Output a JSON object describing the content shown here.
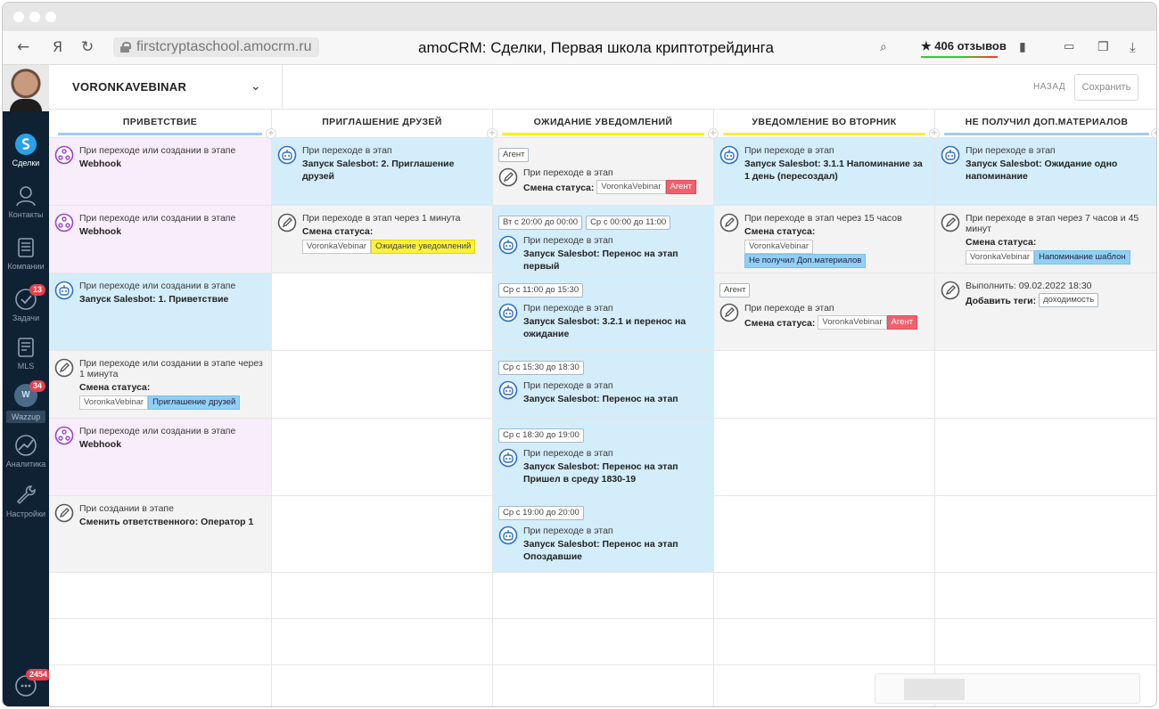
{
  "browser": {
    "url": "firstcryptaschool.amocrm.ru",
    "page_title": "amoCRM: Сделки, Первая школа криптотрейдинга",
    "reviews": "★ 406 отзывов"
  },
  "sidebar": {
    "items": [
      {
        "label": "Сделки"
      },
      {
        "label": "Контакты"
      },
      {
        "label": "Компании"
      },
      {
        "label": "Задачи",
        "badge": "13"
      },
      {
        "label": "MLS"
      },
      {
        "label": "Wazzup",
        "badge": "34",
        "avatar_text": "W"
      },
      {
        "label": "Аналитика"
      },
      {
        "label": "Настройки"
      }
    ],
    "chat_badge": "2454"
  },
  "header": {
    "pipeline": "VORONKAVEBINAR",
    "back": "НАЗАД",
    "save": "Сохранить"
  },
  "columns": [
    {
      "title": "ПРИВЕТСТВИЕ",
      "color": "#99ccfd"
    },
    {
      "title": "ПРИГЛАШЕНИЕ ДРУЗЕЙ",
      "color": "#ffffff"
    },
    {
      "title": "ОЖИДАНИЕ УВЕДОМЛЕНИЙ",
      "color": "#fff000"
    },
    {
      "title": "УВЕДОМЛЕНИЕ ВО ВТОРНИК",
      "color": "#ffeb3b"
    },
    {
      "title": "НЕ ПОЛУЧИЛ ДОП.МАТЕРИАЛОВ",
      "color": "#99ccfd"
    }
  ],
  "cells": {
    "c0r0": {
      "small": "При переходе или создании в этапе",
      "bold": "Webhook"
    },
    "c0r1": {
      "small": "При переходе или создании в этапе",
      "bold": "Webhook"
    },
    "c0r2": {
      "small": "При переходе или создании в этапе",
      "bold": "Запуск Salesbot: 1. Приветствие"
    },
    "c0r3": {
      "small": "При переходе или создании в этапе через 1 минута",
      "bold": "Смена статуса:",
      "chip1": "VoronkaVebinar",
      "chip2": "Приглашение друзей"
    },
    "c0r4": {
      "small": "При переходе или создании в этапе",
      "bold": "Webhook"
    },
    "c0r5": {
      "small": "При создании в этапе",
      "bold": "Сменить ответственного: Оператор 1"
    },
    "c1r0": {
      "small": "При переходе в этап",
      "bold": "Запуск Salesbot: 2. Приглашение друзей"
    },
    "c1r1": {
      "small": "При переходе в этап через 1 минута",
      "bold": "Смена статуса:",
      "chip1": "VoronkaVebinar",
      "chip2": "Ожидание уведомлений"
    },
    "c2r0": {
      "tag": "Агент",
      "small": "При переходе в этап",
      "bold": "Смена статуса:",
      "chip1": "VoronkaVebinar",
      "chip2": "Агент"
    },
    "c2r1": {
      "tag": "Вт с 20:00 до 00:00",
      "tag2": "Ср с 00:00 до 11:00",
      "small": "При переходе в этап",
      "bold": "Запуск Salesbot: Перенос на этап первый"
    },
    "c2r2": {
      "tag": "Ср с 11:00 до 15:30",
      "small": "При переходе в этап",
      "bold": "Запуск Salesbot: 3.2.1 и перенос на ожидание"
    },
    "c2r3": {
      "tag": "Ср с 15:30 до 18:30",
      "small": "При переходе в этап",
      "bold": "Запуск Salesbot: Перенос на этап"
    },
    "c2r4": {
      "tag": "Ср с 18:30 до 19:00",
      "small": "При переходе в этап",
      "bold": "Запуск Salesbot: Перенос на этап Пришел в среду 1830-19"
    },
    "c2r5": {
      "tag": "Ср с 19:00 до 20:00",
      "small": "При переходе в этап",
      "bold": "Запуск Salesbot: Перенос на этап Опоздавшие"
    },
    "c3r0": {
      "small": "При переходе в этап",
      "bold": "Запуск Salesbot: 3.1.1 Напоминание за 1 день (пересоздал)"
    },
    "c3r1": {
      "small": "При переходе в этап через 15 часов",
      "bold": "Смена статуса:",
      "chip1": "VoronkaVebinar",
      "chip2": "Не получил Доп.материалов"
    },
    "c3r2": {
      "tag": "Агент",
      "small": "При переходе в этап",
      "bold": "Смена статуса:",
      "chip1": "VoronkaVebinar",
      "chip2": "Агент"
    },
    "c4r0": {
      "small": "При переходе в этап",
      "bold": "Запуск Salesbot: Ожидание одно напоминание"
    },
    "c4r1": {
      "small": "При переходе в этап через 7 часов и 45 минут",
      "bold": "Смена статуса:",
      "chip1": "VoronkaVebinar",
      "chip2": "Напоминание шаблон"
    },
    "c4r2": {
      "small": "Выполнить: 09.02.2022 18:30",
      "bold": "Добавить теги:",
      "chip1": "доходимость"
    }
  }
}
